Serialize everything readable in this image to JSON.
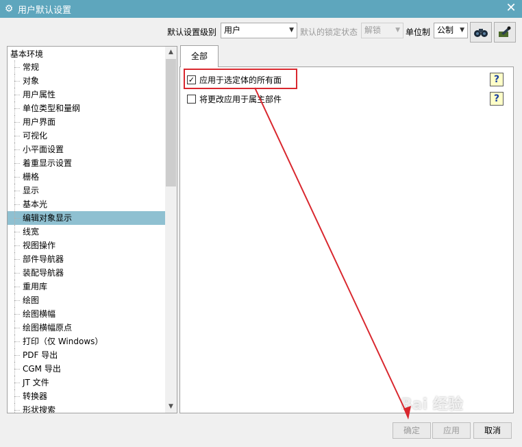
{
  "window": {
    "title": "用户默认设置",
    "close_glyph": "✕",
    "icon": "gear-icon"
  },
  "toolbar": {
    "level_label": "默认设置级别",
    "level_value": "用户",
    "lock_label": "默认的锁定状态",
    "lock_value": "解锁",
    "unit_label": "单位制",
    "unit_value": "公制",
    "icons": [
      "binoculars-icon",
      "manage-icon"
    ]
  },
  "tree": {
    "root": "基本环境",
    "items": [
      "常规",
      "对象",
      "用户属性",
      "单位类型和量纲",
      "用户界面",
      "可视化",
      "小平面设置",
      "着重显示设置",
      "栅格",
      "显示",
      "基本光",
      "编辑对象显示",
      "线宽",
      "视图操作",
      "部件导航器",
      "装配导航器",
      "重用库",
      "绘图",
      "绘图横幅",
      "绘图横幅原点",
      "打印（仅 Windows）",
      "PDF 导出",
      "CGM 导出",
      "JT 文件",
      "转换器",
      "形状搜索"
    ],
    "selected": "编辑对象显示"
  },
  "tabs": {
    "all": "全部"
  },
  "options": {
    "apply_all_faces": {
      "label": "应用于选定体的所有面",
      "checked": true,
      "check_glyph": "✓"
    },
    "apply_owning_part": {
      "label": "将更改应用于属主部件",
      "checked": false
    }
  },
  "help_glyph": "?",
  "buttons": {
    "ok": "确定",
    "apply": "应用",
    "cancel": "取消"
  },
  "watermark": "Bai 经验",
  "colors": {
    "titlebar": "#5ea6bd",
    "selection": "#8fc0d1",
    "annotation": "#d9272e"
  }
}
